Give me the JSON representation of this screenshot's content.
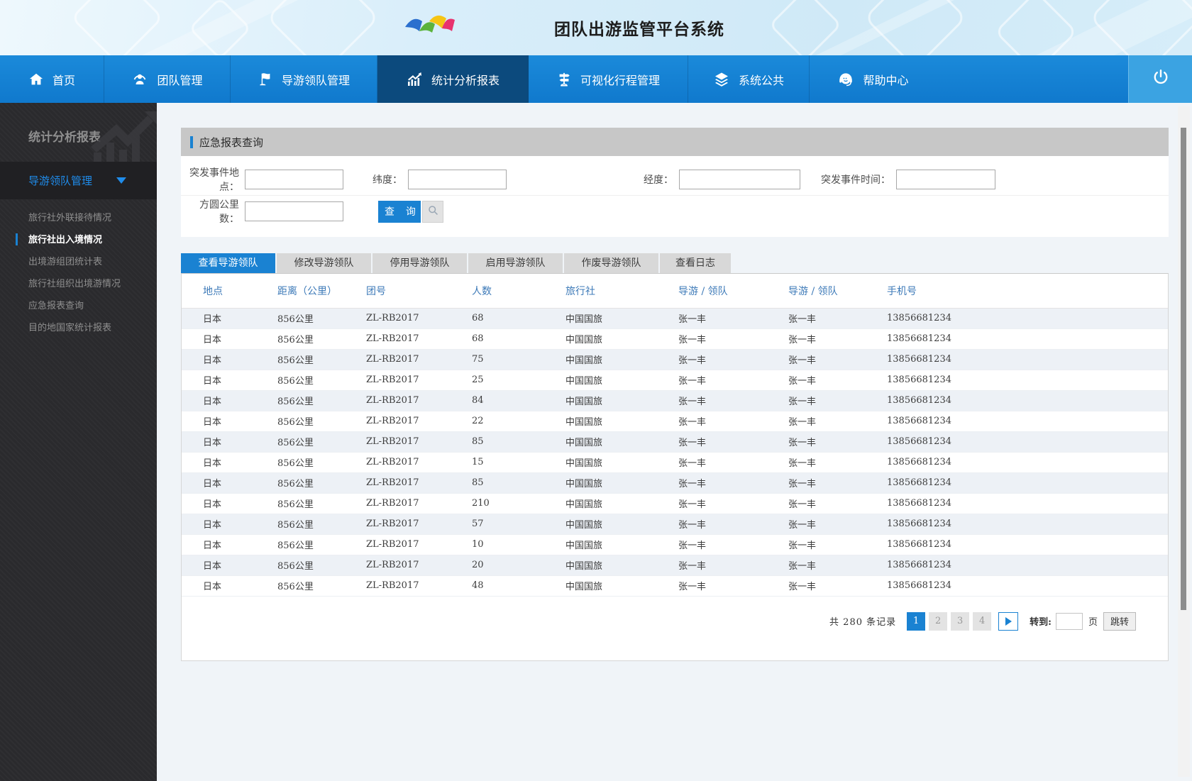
{
  "header": {
    "title": "团队出游监管平台系统"
  },
  "nav": {
    "items": [
      {
        "label": "首页",
        "icon": "home-icon",
        "active": false
      },
      {
        "label": "团队管理",
        "icon": "team-icon",
        "active": false
      },
      {
        "label": "导游领队管理",
        "icon": "flag-icon",
        "active": false
      },
      {
        "label": "统计分析报表",
        "icon": "chart-icon",
        "active": true
      },
      {
        "label": "可视化行程管理",
        "icon": "signpost-icon",
        "active": false
      },
      {
        "label": "系统公共",
        "icon": "layers-icon",
        "active": false
      },
      {
        "label": "帮助中心",
        "icon": "headset-icon",
        "active": false
      }
    ],
    "logout_icon": "power-icon"
  },
  "sidebar": {
    "title": "统计分析报表",
    "group_label": "导游领队管理",
    "items": [
      {
        "label": "旅行社外联接待情况",
        "active": false
      },
      {
        "label": "旅行社出入境情况",
        "active": true
      },
      {
        "label": "出境游组团统计表",
        "active": false
      },
      {
        "label": "旅行社组织出境游情况",
        "active": false
      },
      {
        "label": "应急报表查询",
        "active": false
      },
      {
        "label": "目的地国家统计报表",
        "active": false
      }
    ]
  },
  "query_panel": {
    "title": "应急报表查询",
    "fields": [
      {
        "label": "突发事件地点：",
        "value": ""
      },
      {
        "label": "纬度：",
        "value": ""
      },
      {
        "label": "经度：",
        "value": ""
      },
      {
        "label": "突发事件时间：",
        "value": ""
      },
      {
        "label": "方圆公里数：",
        "value": ""
      }
    ],
    "search_button": "查 询",
    "search_icon": "magnifier-icon"
  },
  "tabs": [
    {
      "label": "查看导游领队",
      "active": true
    },
    {
      "label": "修改导游领队",
      "active": false
    },
    {
      "label": "停用导游领队",
      "active": false
    },
    {
      "label": "启用导游领队",
      "active": false
    },
    {
      "label": "作废导游领队",
      "active": false
    },
    {
      "label": "查看日志",
      "active": false
    }
  ],
  "table": {
    "headers": [
      "地点",
      "距离（公里）",
      "团号",
      "人数",
      "旅行社",
      "导游 / 领队",
      "导游 / 领队",
      "手机号"
    ],
    "rows": [
      [
        "日本",
        "856公里",
        "ZL-RB2017",
        "68",
        "中国国旅",
        "张一丰",
        "张一丰",
        "13856681234"
      ],
      [
        "日本",
        "856公里",
        "ZL-RB2017",
        "68",
        "中国国旅",
        "张一丰",
        "张一丰",
        "13856681234"
      ],
      [
        "日本",
        "856公里",
        "ZL-RB2017",
        "75",
        "中国国旅",
        "张一丰",
        "张一丰",
        "13856681234"
      ],
      [
        "日本",
        "856公里",
        "ZL-RB2017",
        "25",
        "中国国旅",
        "张一丰",
        "张一丰",
        "13856681234"
      ],
      [
        "日本",
        "856公里",
        "ZL-RB2017",
        "84",
        "中国国旅",
        "张一丰",
        "张一丰",
        "13856681234"
      ],
      [
        "日本",
        "856公里",
        "ZL-RB2017",
        "22",
        "中国国旅",
        "张一丰",
        "张一丰",
        "13856681234"
      ],
      [
        "日本",
        "856公里",
        "ZL-RB2017",
        "85",
        "中国国旅",
        "张一丰",
        "张一丰",
        "13856681234"
      ],
      [
        "日本",
        "856公里",
        "ZL-RB2017",
        "15",
        "中国国旅",
        "张一丰",
        "张一丰",
        "13856681234"
      ],
      [
        "日本",
        "856公里",
        "ZL-RB2017",
        "85",
        "中国国旅",
        "张一丰",
        "张一丰",
        "13856681234"
      ],
      [
        "日本",
        "856公里",
        "ZL-RB2017",
        "210",
        "中国国旅",
        "张一丰",
        "张一丰",
        "13856681234"
      ],
      [
        "日本",
        "856公里",
        "ZL-RB2017",
        "57",
        "中国国旅",
        "张一丰",
        "张一丰",
        "13856681234"
      ],
      [
        "日本",
        "856公里",
        "ZL-RB2017",
        "10",
        "中国国旅",
        "张一丰",
        "张一丰",
        "13856681234"
      ],
      [
        "日本",
        "856公里",
        "ZL-RB2017",
        "20",
        "中国国旅",
        "张一丰",
        "张一丰",
        "13856681234"
      ],
      [
        "日本",
        "856公里",
        "ZL-RB2017",
        "48",
        "中国国旅",
        "张一丰",
        "张一丰",
        "13856681234"
      ]
    ]
  },
  "pagination": {
    "total_prefix": "共",
    "total": "280",
    "total_suffix": "条记录",
    "pages": [
      "1",
      "2",
      "3",
      "4"
    ],
    "active_page": "1",
    "goto_label": "转到:",
    "goto_value": "",
    "page_label": "页",
    "jump_label": "跳转"
  },
  "colors": {
    "accent": "#1a82d2",
    "nav_bg": "#1583d6",
    "nav_active": "#0c4a7d",
    "power_bg": "#3ba3e2",
    "sidebar_bg": "#2a2a2d",
    "panel_header_bg": "#c7c7c7",
    "row_stripe": "#edf1f6",
    "table_header_text": "#3d7ab8"
  },
  "icons": {
    "logo": "ribbon-logo",
    "nav": [
      "home-icon",
      "team-icon",
      "flag-icon",
      "chart-icon",
      "signpost-icon",
      "layers-icon",
      "headset-icon"
    ],
    "logout": "power-icon",
    "search": "magnifier-icon",
    "sidebar_caret": "caret-down-icon",
    "sidebar_watermark": "chart-watermark-icon",
    "next_page": "play-arrow-icon"
  }
}
